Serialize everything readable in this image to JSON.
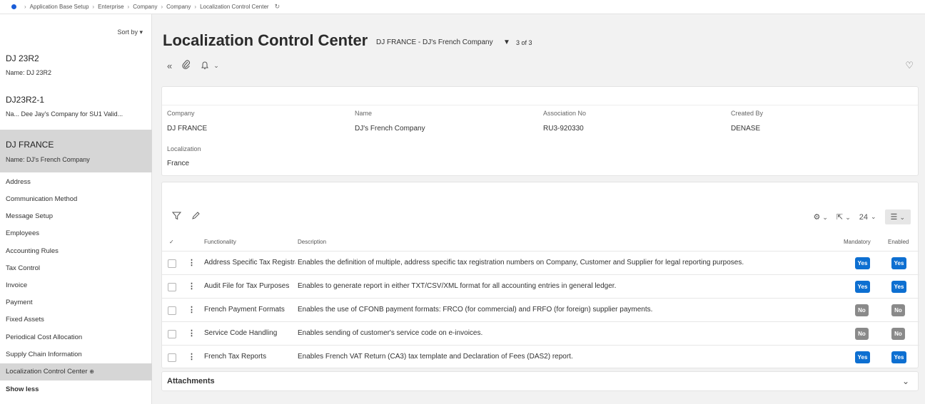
{
  "breadcrumb": {
    "items": [
      "Application Base Setup",
      "Enterprise",
      "Company",
      "Company",
      "Localization Control Center"
    ]
  },
  "sidebar": {
    "sort_label": "Sort by",
    "records": [
      {
        "title": "DJ 23R2",
        "name": "Name:  DJ 23R2"
      },
      {
        "title": "DJ23R2-1",
        "name": "Na...   Dee Jay's Company for SU1 Valid..."
      },
      {
        "title": "DJ FRANCE",
        "name": "Name:  DJ's French Company"
      }
    ],
    "nav": [
      "Address",
      "Communication Method",
      "Message Setup",
      "Employees",
      "Accounting Rules",
      "Tax Control",
      "Invoice",
      "Payment",
      "Fixed Assets",
      "Periodical Cost Allocation",
      "Supply Chain Information",
      "Localization Control Center",
      "Show less"
    ]
  },
  "header": {
    "title": "Localization Control Center",
    "subtitle": "DJ FRANCE - DJ's French Company",
    "record_count": "3 of 3"
  },
  "details": {
    "company_label": "Company",
    "company_value": "DJ FRANCE",
    "name_label": "Name",
    "name_value": "DJ's French Company",
    "association_label": "Association No",
    "association_value": "RU3-920330",
    "created_by_label": "Created By",
    "created_by_value": "DENASE",
    "localization_label": "Localization",
    "localization_value": "France"
  },
  "table": {
    "page_size": "24",
    "columns": {
      "functionality": "Functionality",
      "description": "Description",
      "mandatory": "Mandatory",
      "enabled": "Enabled"
    },
    "rows": [
      {
        "functionality": "Address Specific Tax Registration",
        "description": "Enables the definition of multiple, address specific tax registration numbers on Company, Customer and Supplier for legal reporting purposes.",
        "mandatory": "Yes",
        "enabled": "Yes"
      },
      {
        "functionality": "Audit File for Tax Purposes",
        "description": "Enables to generate report in either TXT/CSV/XML format for all accounting entries in general ledger.",
        "mandatory": "Yes",
        "enabled": "Yes"
      },
      {
        "functionality": "French Payment Formats",
        "description": "Enables the use of CFONB payment formats: FRCO (for commercial) and FRFO (for foreign) supplier payments.",
        "mandatory": "No",
        "enabled": "No"
      },
      {
        "functionality": "Service Code Handling",
        "description": "Enables sending of customer's service code on e-invoices.",
        "mandatory": "No",
        "enabled": "No"
      },
      {
        "functionality": "French Tax Reports",
        "description": "Enables French VAT Return (CA3) tax template and Declaration of Fees (DAS2) report.",
        "mandatory": "Yes",
        "enabled": "Yes"
      }
    ]
  },
  "attachments": {
    "label": "Attachments"
  },
  "colors": {
    "accent": "#0d6fd1",
    "badge_no": "#8a8a8a",
    "active_bg": "#d6d6d6"
  }
}
